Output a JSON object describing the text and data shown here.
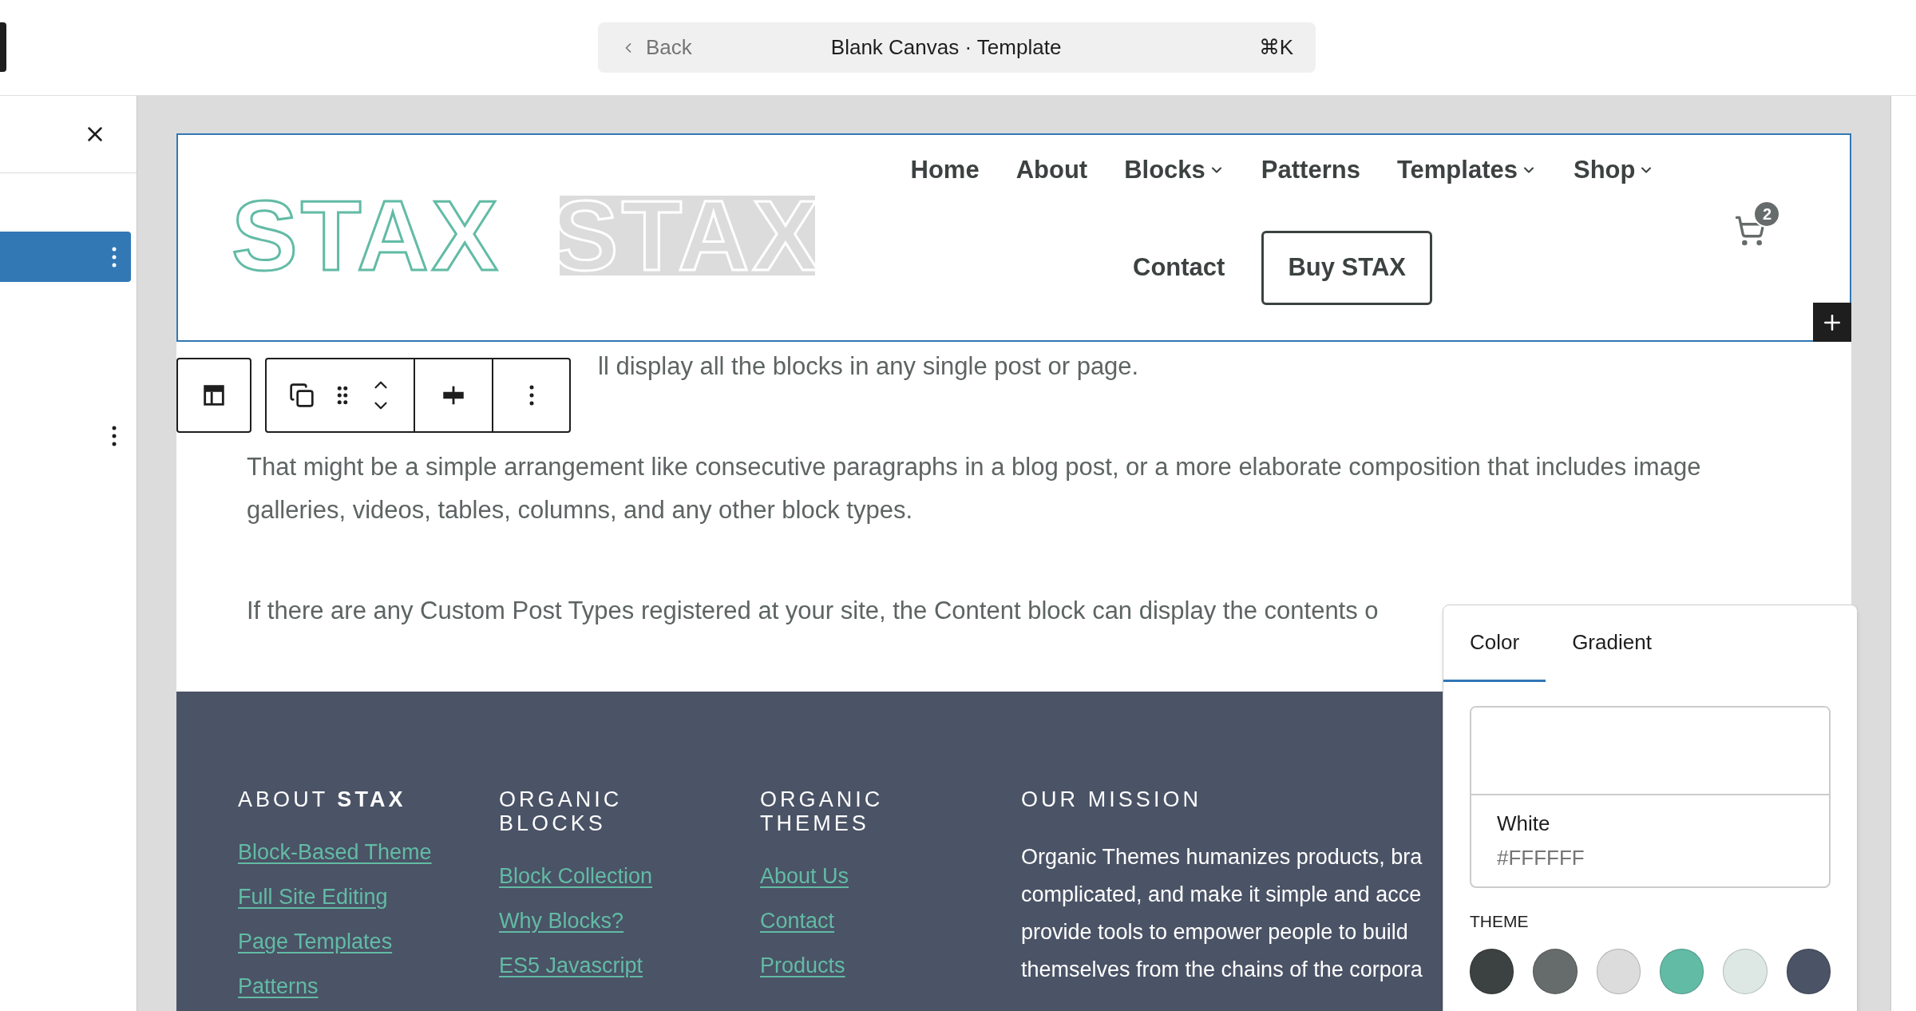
{
  "top_bar": {
    "back": "Back",
    "title": "Blank Canvas · Template",
    "shortcut": "⌘K"
  },
  "sidebar": {
    "items": [
      {
        "selected": true
      },
      {
        "selected": false
      }
    ]
  },
  "header": {
    "logos": [
      {
        "text": "STAX",
        "kind": "color"
      },
      {
        "text": "STAX",
        "kind": "placeholder"
      }
    ],
    "nav_rows": [
      [
        {
          "label": "Home",
          "kind": "link",
          "submenu": false
        },
        {
          "label": "About",
          "kind": "link",
          "submenu": false
        },
        {
          "label": "Blocks",
          "kind": "link",
          "submenu": true
        },
        {
          "label": "Patterns",
          "kind": "link",
          "submenu": false
        },
        {
          "label": "Templates",
          "kind": "link",
          "submenu": true
        },
        {
          "label": "Shop",
          "kind": "link",
          "submenu": true
        }
      ],
      [
        {
          "label": "Contact",
          "kind": "link",
          "submenu": false
        },
        {
          "label": "Buy STAX",
          "kind": "button"
        }
      ]
    ],
    "cart_count": "2"
  },
  "content": {
    "paragraphs": [
      {
        "text": "ll display all the blocks in any single post or page.",
        "kind": "partial"
      },
      {
        "text": "That might be a simple arrangement like consecutive paragraphs in a blog post, or a more elaborate composition that includes image galleries, videos, tables, columns, and any other block types.",
        "kind": "full"
      },
      {
        "text": "If there are any Custom Post Types registered at your site, the Content block can display the contents o",
        "kind": "full"
      }
    ]
  },
  "footer": {
    "columns": [
      {
        "heading": "ABOUT **STAX**",
        "links": [
          "Block-Based Theme",
          "Full Site Editing",
          "Page Templates",
          "Patterns"
        ]
      },
      {
        "heading": "ORGANIC BLOCKS",
        "links": [
          "Block Collection",
          "Why Blocks?",
          "ES5 Javascript"
        ]
      },
      {
        "heading": "ORGANIC THEMES",
        "links": [
          "About Us",
          "Contact",
          "Products"
        ]
      },
      {
        "heading": "OUR MISSION",
        "lines": [
          "Organic Themes humanizes products, bra",
          "complicated, and make it simple and acce",
          "provide tools to empower people to build",
          "themselves from the chains of the corpora"
        ]
      }
    ]
  },
  "color_popover": {
    "tabs": [
      {
        "label": "Color",
        "selected": true
      },
      {
        "label": "Gradient",
        "selected": false
      }
    ],
    "current": {
      "name": "White",
      "hex": "#FFFFFF",
      "color": "#ffffff"
    },
    "section": "THEME",
    "swatches": [
      {
        "color": "#3c4241"
      },
      {
        "color": "#666b6b"
      },
      {
        "color": "#dcdcdc"
      },
      {
        "color": "#62bba5"
      },
      {
        "color": "#dde8e5"
      },
      {
        "color": "#4b5366"
      }
    ]
  }
}
